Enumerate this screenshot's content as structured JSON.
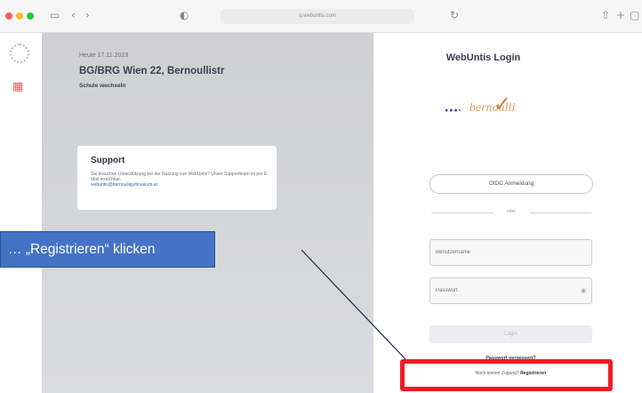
{
  "browser": {
    "url": "q.webuntis.com",
    "icons": {
      "sidebar": "sidebar-icon",
      "back": "back-icon",
      "forward": "forward-icon",
      "shield": "shield-icon",
      "refresh": "refresh-icon",
      "share": "share-icon",
      "new_tab": "plus-icon",
      "tabs": "tabs-icon"
    },
    "traffic_colors": [
      "#ff5f57",
      "#febc2e",
      "#28c840"
    ]
  },
  "rail": {
    "logo_icon": "webuntis-logo-icon",
    "calendar_icon": "calendar-icon",
    "accent": "#e2625a"
  },
  "school_panel": {
    "date": "Heute 17.11.2023",
    "school_name": "BG/BRG Wien 22, Bernoullistr",
    "change_school": "Schule wechseln",
    "support": {
      "title": "Support",
      "text": "Sie brauchen Unterstützung bei der Nutzung von WebUntis? Unser Supportteam ist per E-Mail erreichbar:",
      "email": "webuntis@bernoulligymnasium.at"
    }
  },
  "login": {
    "title": "WebUntis Login",
    "logo_text": "bernoulli",
    "oidc_button": "OIDC Anmeldung",
    "divider": "oder",
    "username_placeholder": "Benutzername",
    "password_placeholder": "Passwort",
    "login_button": "Login",
    "forgot_password": "Passwort vergessen?",
    "no_access": "Noch keinen Zugang?",
    "register": "Registrieren"
  },
  "annotation": {
    "callout_text": "… „Registrieren“ klicken",
    "box_color": "#4472c4",
    "highlight_color": "#ee1c25"
  }
}
